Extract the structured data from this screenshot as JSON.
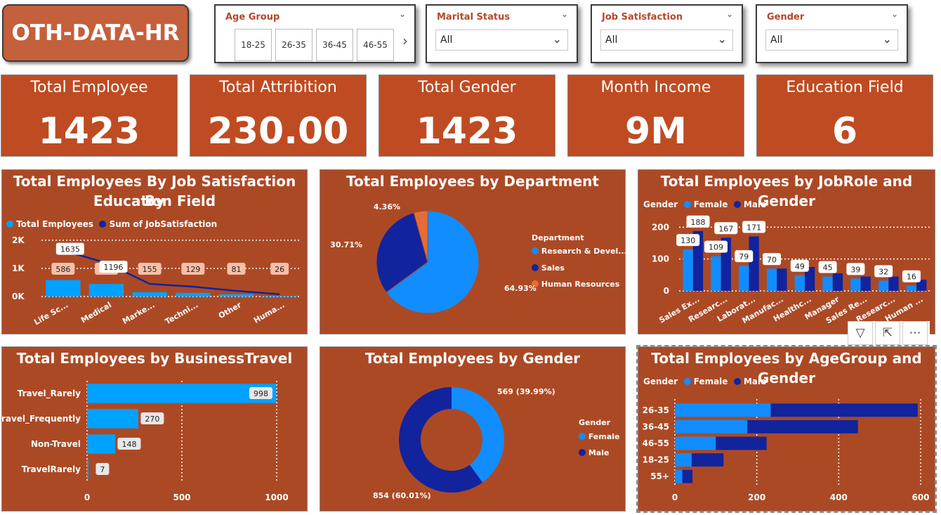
{
  "header": {
    "logo": "OTH-DATA-HR"
  },
  "slicers": {
    "age_group": {
      "title": "Age Group",
      "tiles": [
        "18-25",
        "26-35",
        "36-45",
        "46-55"
      ]
    },
    "marital": {
      "title": "Marital Status",
      "value": "All"
    },
    "job_sat": {
      "title": "Job Satisfaction",
      "value": "All"
    },
    "gender": {
      "title": "Gender",
      "value": "All"
    }
  },
  "kpis": [
    {
      "title": "Total Employee",
      "value": "1423"
    },
    {
      "title": "Total Attribition",
      "value": "230.00"
    },
    {
      "title": "Total Gender",
      "value": "1423"
    },
    {
      "title": "Month Income",
      "value": "9M"
    },
    {
      "title": "Education Field",
      "value": "6"
    }
  ],
  "colors": {
    "light_blue": "#118dff",
    "dark_blue": "#12239e",
    "orange": "#e66c37",
    "panel": "#ac4925",
    "kpi": "#bf4b22",
    "bar_blue": "#00a2ff"
  },
  "panels": {
    "edu": {
      "title_line1": "Total Employees By Job Satisfaction By",
      "title_line2": "Education Field",
      "legend1": "Total Employees",
      "legend2": "Sum of JobSatisfaction"
    },
    "dept": {
      "title": "Total Employees by Department",
      "legend_title": "Department"
    },
    "jobrole": {
      "title": "Total Employees by JobRole and Gender",
      "legend_title": "Gender",
      "legend1": "Female",
      "legend2": "Male"
    },
    "travel": {
      "title": "Total Employees by BusinessTravel"
    },
    "gender": {
      "title": "Total Employees by Gender",
      "legend_title": "Gender"
    },
    "age": {
      "title": "Total Employees by AgeGroup and Gender",
      "legend_title": "Gender",
      "legend1": "Female",
      "legend2": "Male"
    }
  },
  "chart_data": [
    {
      "id": "edu",
      "type": "bar",
      "categories": [
        "Life Sc...",
        "Medical",
        "Marke...",
        "Techni...",
        "Other",
        "Huma..."
      ],
      "series": [
        {
          "name": "Total Employees",
          "values": [
            586,
            446,
            155,
            129,
            81,
            26
          ]
        },
        {
          "name": "Sum of JobSatisfaction",
          "values": [
            1635,
            1196,
            450,
            350,
            200,
            80
          ]
        }
      ],
      "data_labels_bar": [
        "586",
        "446",
        "155",
        "129",
        "81",
        "26"
      ],
      "data_labels_line": [
        "1635",
        "1196"
      ],
      "yticks": [
        "0K",
        "1K",
        "2K"
      ],
      "ylim": [
        0,
        2000
      ]
    },
    {
      "id": "dept",
      "type": "pie",
      "categories": [
        "Research & Devel...",
        "Sales",
        "Human Resources"
      ],
      "values": [
        64.93,
        30.71,
        4.36
      ],
      "labels": [
        "64.93%",
        "30.71%",
        "4.36%"
      ]
    },
    {
      "id": "jobrole",
      "type": "bar",
      "categories": [
        "Sales Ex...",
        "Researc...",
        "Laborat...",
        "Manufac...",
        "Healthc...",
        "Manager",
        "Sales Re...",
        "Researc...",
        "Human ..."
      ],
      "series": [
        {
          "name": "Female",
          "values": [
            130,
            109,
            79,
            70,
            49,
            45,
            39,
            32,
            16
          ]
        },
        {
          "name": "Male",
          "values": [
            188,
            167,
            171,
            70,
            75,
            55,
            45,
            45,
            35
          ]
        }
      ],
      "data_labels": [
        "130",
        "188",
        "109",
        "167",
        "79",
        "171",
        "70",
        "49",
        "45",
        "39",
        "32",
        "16"
      ],
      "yticks": [
        "0",
        "100",
        "200"
      ],
      "ylim": [
        0,
        225
      ]
    },
    {
      "id": "travel",
      "type": "bar",
      "orientation": "horizontal",
      "categories": [
        "Travel_Rarely",
        "Travel_Frequently",
        "Non-Travel",
        "TravelRarely"
      ],
      "values": [
        998,
        270,
        148,
        7
      ],
      "data_labels": [
        "998",
        "270",
        "148",
        "7"
      ],
      "xticks": [
        "0",
        "500",
        "1000"
      ],
      "xlim": [
        0,
        1000
      ]
    },
    {
      "id": "gender",
      "type": "pie",
      "variant": "donut",
      "categories": [
        "Female",
        "Male"
      ],
      "values": [
        569,
        854
      ],
      "labels": [
        "569 (39.99%)",
        "854 (60.01%)"
      ]
    },
    {
      "id": "age",
      "type": "bar",
      "orientation": "horizontal",
      "stacked": true,
      "categories": [
        "26-35",
        "36-45",
        "46-55",
        "18-25",
        "55+"
      ],
      "series": [
        {
          "name": "Female",
          "values": [
            234,
            177,
            100,
            41,
            18
          ]
        },
        {
          "name": "Male",
          "values": [
            359,
            270,
            124,
            78,
            25
          ]
        }
      ],
      "xticks": [
        "0",
        "200",
        "400",
        "600"
      ],
      "xlim": [
        0,
        600
      ]
    }
  ]
}
